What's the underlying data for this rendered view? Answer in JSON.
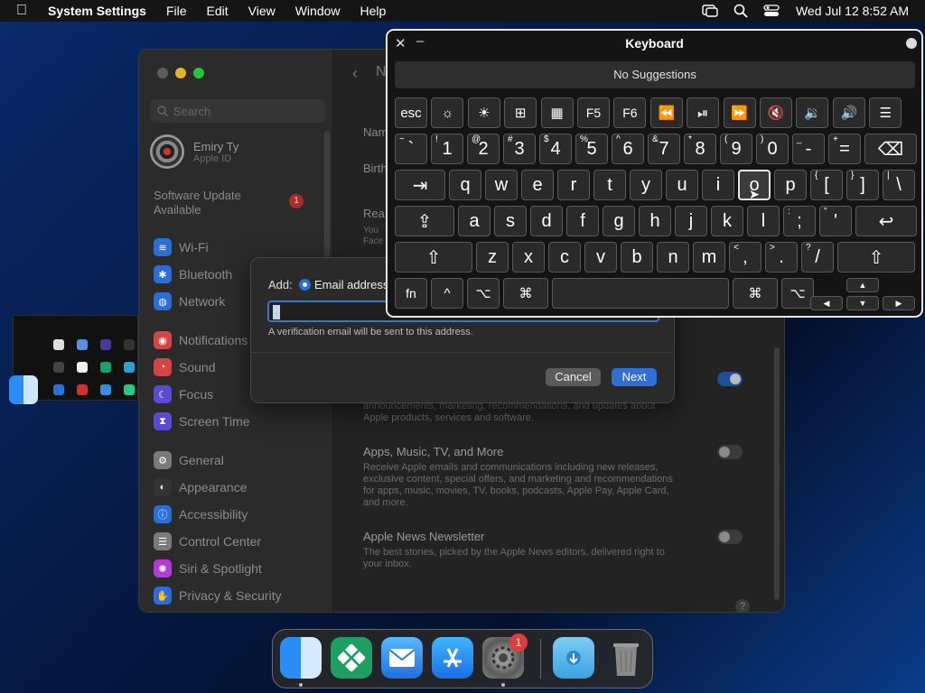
{
  "menubar": {
    "app": "System Settings",
    "items": [
      "File",
      "Edit",
      "View",
      "Window",
      "Help"
    ],
    "clock": "Wed Jul 12  8:52 AM"
  },
  "sidebar": {
    "search_placeholder": "Search",
    "account": {
      "name": "Emiry Ty",
      "sub": "Apple ID"
    },
    "software_update": "Software Update Available",
    "software_update_badge": "1",
    "items": [
      {
        "label": "Wi-Fi",
        "color": "#2a6ed8"
      },
      {
        "label": "Bluetooth",
        "color": "#2a6ed8"
      },
      {
        "label": "Network",
        "color": "#2a6ed8"
      },
      {
        "label": "Notifications",
        "color": "#d64545"
      },
      {
        "label": "Sound",
        "color": "#d64545"
      },
      {
        "label": "Focus",
        "color": "#5a4bd6"
      },
      {
        "label": "Screen Time",
        "color": "#5a4bd6"
      },
      {
        "label": "General",
        "color": "#7a7a7a"
      },
      {
        "label": "Appearance",
        "color": "#333333"
      },
      {
        "label": "Accessibility",
        "color": "#2a6ed8"
      },
      {
        "label": "Control Center",
        "color": "#7a7a7a"
      },
      {
        "label": "Siri & Spotlight",
        "color": "#b03bd6"
      },
      {
        "label": "Privacy & Security",
        "color": "#2a6ed8"
      }
    ]
  },
  "content": {
    "title": "N",
    "field_name": "Nam",
    "field_birth": "Birth",
    "field_rea": "Rea",
    "field_rea_desc1": "You",
    "field_rea_desc2": "Face",
    "section1_desc": "announcements, marketing, recommendations, and updates about Apple products, services and software.",
    "section2_title": "Apps, Music, TV, and More",
    "section2_desc": "Receive Apple emails and communications including new releases, exclusive content, special offers, and marketing and recommendations for apps, music, movies, TV, books, podcasts, Apple Pay, Apple Card, and more.",
    "section3_title": "Apple News Newsletter",
    "section3_desc": "The best stories, picked by the Apple News editors, delivered right to your inbox.",
    "help": "?"
  },
  "sheet": {
    "add_label": "Add:",
    "radio_label": "Email address",
    "input_value": "i",
    "note": "A verification email will be sent to this address.",
    "cancel": "Cancel",
    "next": "Next"
  },
  "keyboard": {
    "title": "Keyboard",
    "suggestions": "No Suggestions"
  },
  "dock": {
    "settings_badge": "1"
  }
}
